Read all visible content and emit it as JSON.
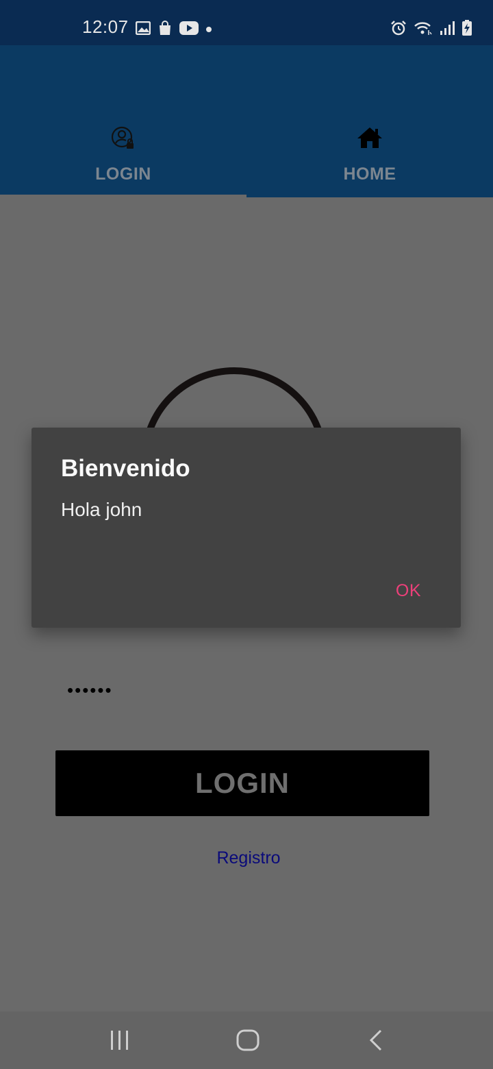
{
  "status_bar": {
    "time": "12:07",
    "left_icons": [
      "image-icon",
      "shopping-bag-icon",
      "youtube-icon",
      "dot-icon"
    ],
    "right_icons": [
      "alarm-icon",
      "wifi-icon",
      "signal-icon",
      "battery-charging-icon"
    ]
  },
  "tabs": [
    {
      "label": "LOGIN",
      "icon": "account-lock-icon",
      "selected": true
    },
    {
      "label": "HOME",
      "icon": "home-icon",
      "selected": false
    }
  ],
  "login_form": {
    "password_value": "••••••",
    "login_button": "LOGIN",
    "register_link": "Registro"
  },
  "dialog": {
    "title": "Bienvenido",
    "message": "Hola john",
    "ok_button": "OK"
  },
  "navigation_bar": {
    "buttons": [
      "recent-apps-icon",
      "home-circle-icon",
      "back-icon"
    ]
  },
  "colors": {
    "status_bar": "#0a2b52",
    "app_bar": "#0b3a62",
    "dialog_bg": "#424242",
    "ok_accent": "#ec407a",
    "register_link": "#0a0a7a"
  }
}
